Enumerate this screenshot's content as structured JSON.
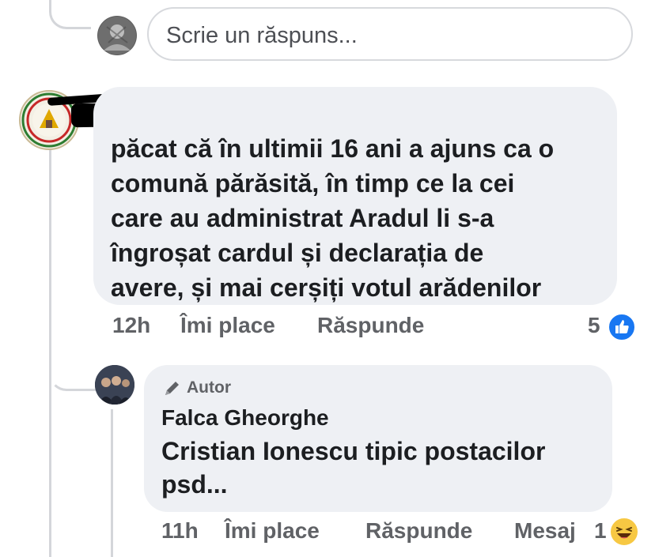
{
  "reply_input": {
    "placeholder": "Scrie un răspuns..."
  },
  "comment1": {
    "lines": [
      "păcat că în ultimii 16 ani a ajuns ca o",
      "comună părăsită, în timp ce la cei",
      "care au administrat Aradul li s-a",
      "îngroșat cardul și declarația de",
      "avere, și mai cerșiți votul arădenilor"
    ],
    "time": "12h",
    "like_label": "Îmi place",
    "reply_label": "Răspunde",
    "reaction_count": "5",
    "reaction_icon": "like-icon"
  },
  "comment2": {
    "badge": "Autor",
    "author": "Falca Gheorghe",
    "lines": [
      "Cristian Ionescu tipic postacilor",
      "psd..."
    ],
    "time": "11h",
    "like_label": "Îmi place",
    "reply_label": "Răspunde",
    "message_label": "Mesaj",
    "reaction_count": "1",
    "reaction_icon": "haha-icon"
  },
  "colors": {
    "bubble": "#eef0f4",
    "like_blue": "#1877f2",
    "haha_yellow": "#f7c843",
    "text": "#1c1e21",
    "meta": "#606266"
  }
}
